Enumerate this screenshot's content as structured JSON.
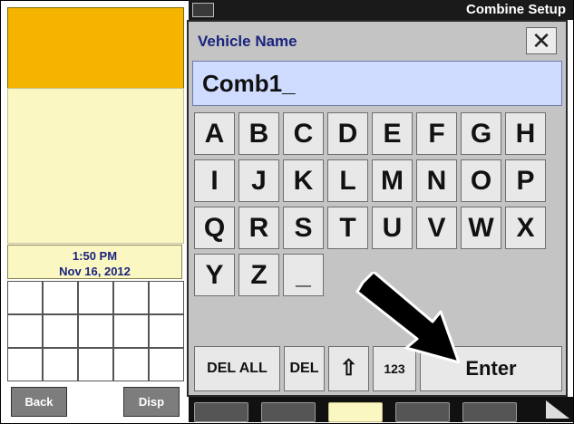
{
  "screen": {
    "title": "Combine Setup"
  },
  "left_panel": {
    "clock": {
      "time": "1:50 PM",
      "date": "Nov 16, 2012"
    },
    "buttons": {
      "back": "Back",
      "disp": "Disp"
    }
  },
  "dialog": {
    "title": "Vehicle Name",
    "close_symbol": "✕",
    "field_value": "Comb1_",
    "keys_row1": [
      "A",
      "B",
      "C",
      "D",
      "E",
      "F",
      "G",
      "H"
    ],
    "keys_row2": [
      "I",
      "J",
      "K",
      "L",
      "M",
      "N",
      "O",
      "P"
    ],
    "keys_row3": [
      "Q",
      "R",
      "S",
      "T",
      "U",
      "V",
      "W",
      "X"
    ],
    "keys_row4": [
      "Y",
      "Z",
      "_"
    ],
    "bottom": {
      "del_all": "DEL ALL",
      "del": "DEL",
      "shift_symbol": "⇧",
      "numeric": "123",
      "enter": "Enter"
    }
  },
  "colors": {
    "orange_panel": "#f5b400",
    "yellow_panel": "#fbf7c2",
    "title_blue": "#1a237e",
    "field_bg": "#cfdcff",
    "dialog_bg": "#c4c4c4"
  }
}
